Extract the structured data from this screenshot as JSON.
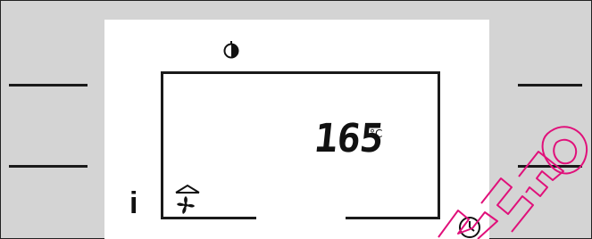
{
  "display": {
    "temperature": "165",
    "unit": "°C",
    "info_symbol": "i"
  },
  "icons": {
    "top": "timer-pie-icon",
    "mode_top": "top-heat-icon",
    "mode_fan": "fan-icon",
    "clock": "clock-icon"
  },
  "colors": {
    "panel": "#d4d4d4",
    "screen": "#ffffff",
    "segments": "#1a1a1a",
    "watermark": "#e0107a"
  }
}
